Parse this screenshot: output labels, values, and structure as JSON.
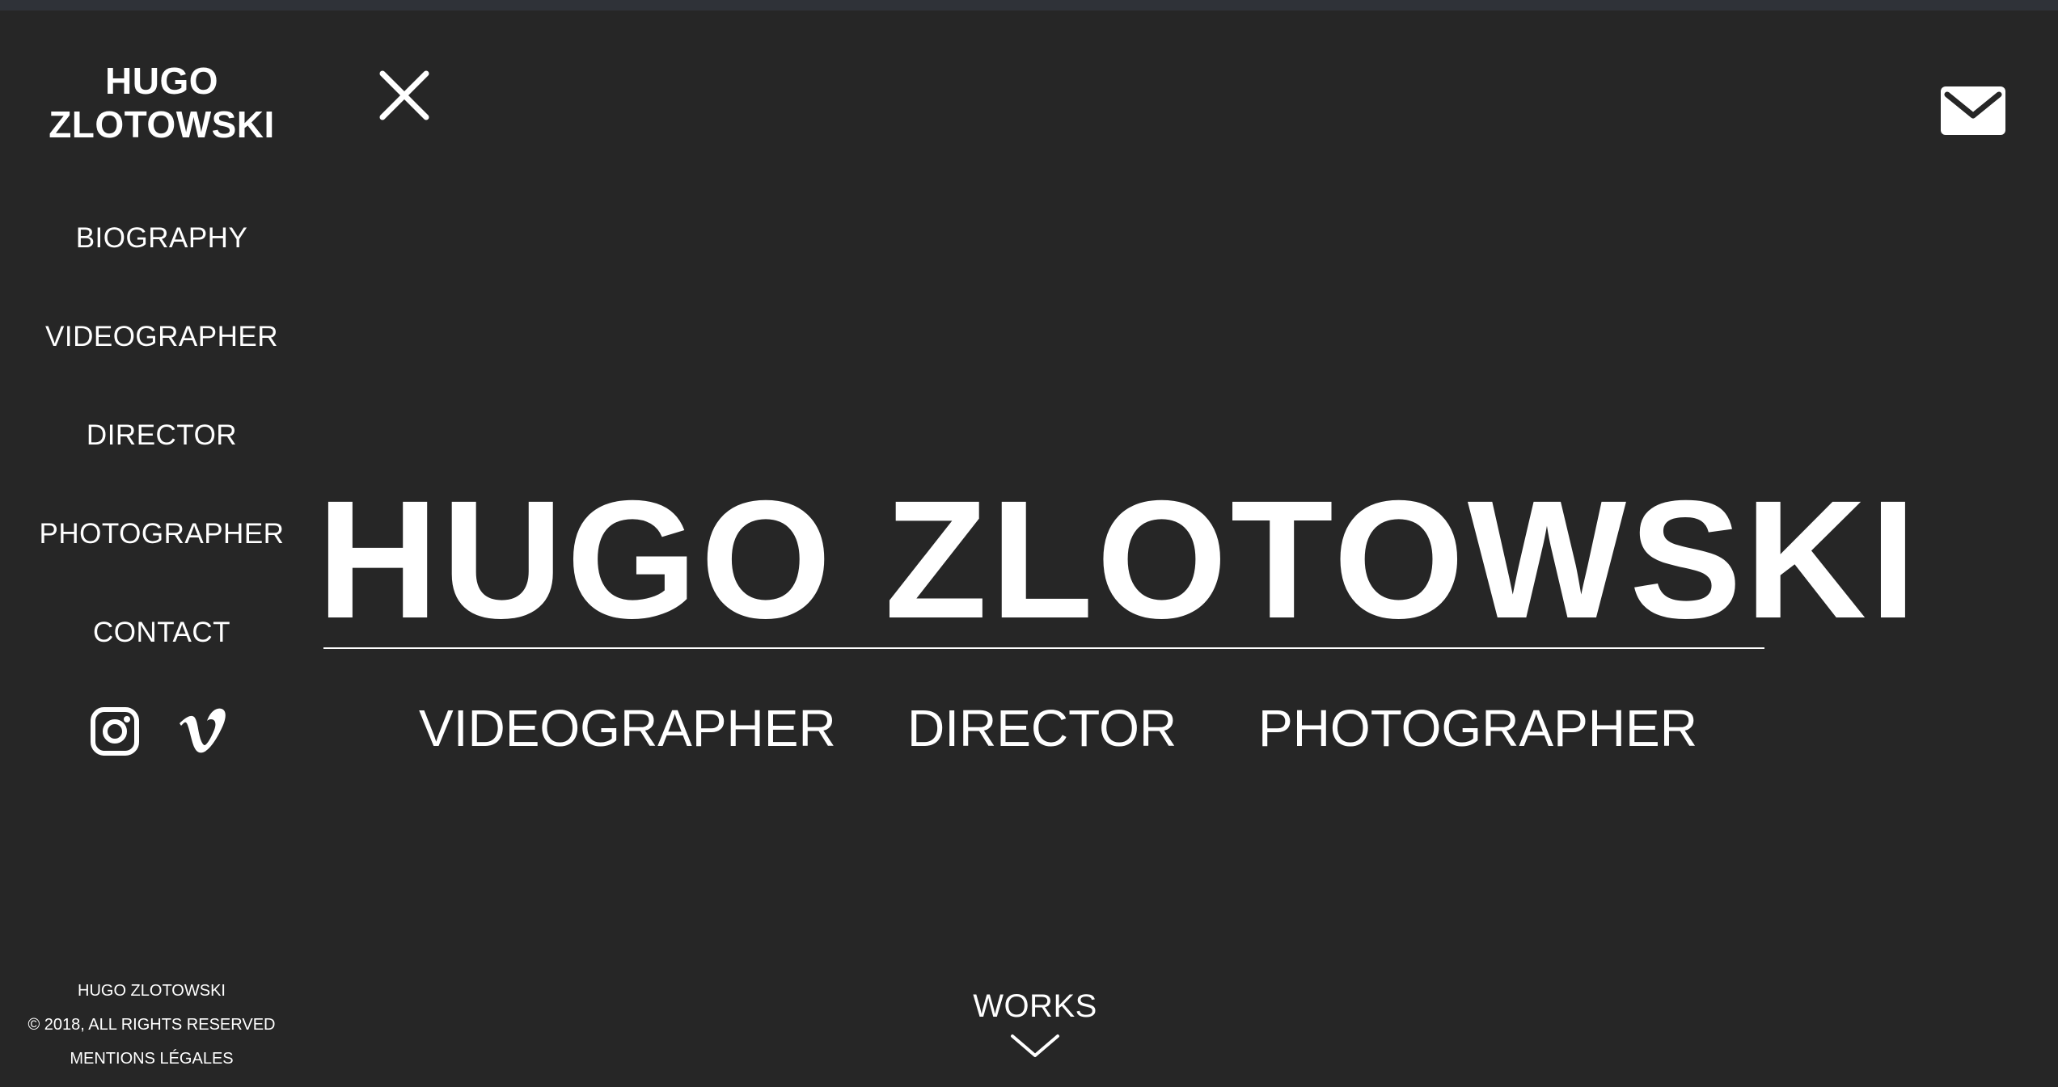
{
  "brand": {
    "line1": "HUGO",
    "line2": "ZLOTOWSKI"
  },
  "nav": {
    "items": [
      {
        "label": "BIOGRAPHY"
      },
      {
        "label": "VIDEOGRAPHER"
      },
      {
        "label": "DIRECTOR"
      },
      {
        "label": "PHOTOGRAPHER"
      },
      {
        "label": "CONTACT"
      }
    ]
  },
  "social": {
    "icons": [
      "instagram-icon",
      "vimeo-icon"
    ]
  },
  "footer": {
    "name": "HUGO ZLOTOWSKI",
    "copyright": "© 2018, ALL RIGHTS RESERVED",
    "legal": "MENTIONS LÉGALES"
  },
  "hero": {
    "title": "HUGO ZLOTOWSKI",
    "roles": [
      "VIDEOGRAPHER",
      "DIRECTOR",
      "PHOTOGRAPHER"
    ]
  },
  "works": {
    "label": "WORKS"
  },
  "icons": {
    "close": "close-icon",
    "mail": "mail-icon",
    "works_arrow": "chevron-down-icon"
  },
  "colors": {
    "background": "#262626",
    "text": "#ffffff",
    "top_strip": "#2f3238"
  }
}
